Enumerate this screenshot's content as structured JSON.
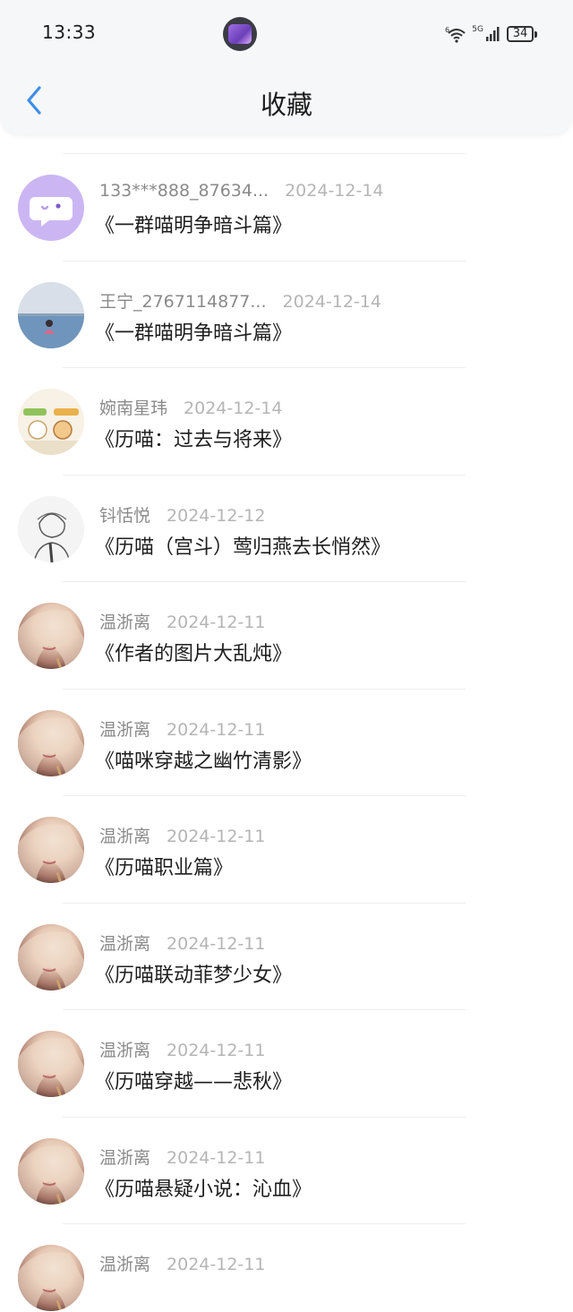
{
  "status_bar": {
    "time": "13:33",
    "network": "5G",
    "battery": "34"
  },
  "header": {
    "title": "收藏"
  },
  "items": [
    {
      "user": "133***888_87634...",
      "date": "2024-12-14",
      "title": "《一群喵明争暗斗篇》",
      "avatar": "chat-bubble-avatar"
    },
    {
      "user": "王宁_2767114877...",
      "date": "2024-12-14",
      "title": "《一群喵明争暗斗篇》",
      "avatar": "lake-photo-avatar"
    },
    {
      "user": "婉南星玮",
      "date": "2024-12-14",
      "title": "《历喵：过去与将来》",
      "avatar": "cartoon-cats-avatar"
    },
    {
      "user": "钭恬悦",
      "date": "2024-12-12",
      "title": "《历喵（宫斗）莺归燕去长悄然》",
      "avatar": "sketch-boy-avatar"
    },
    {
      "user": "温浙离",
      "date": "2024-12-11",
      "title": "《作者的图片大乱炖》",
      "avatar": "portrait-avatar"
    },
    {
      "user": "温浙离",
      "date": "2024-12-11",
      "title": "《喵咪穿越之幽竹清影》",
      "avatar": "portrait-avatar"
    },
    {
      "user": "温浙离",
      "date": "2024-12-11",
      "title": "《历喵职业篇》",
      "avatar": "portrait-avatar"
    },
    {
      "user": "温浙离",
      "date": "2024-12-11",
      "title": "《历喵联动菲梦少女》",
      "avatar": "portrait-avatar"
    },
    {
      "user": "温浙离",
      "date": "2024-12-11",
      "title": "《历喵穿越——悲秋》",
      "avatar": "portrait-avatar"
    },
    {
      "user": "温浙离",
      "date": "2024-12-11",
      "title": "《历喵悬疑小说：沁血》",
      "avatar": "portrait-avatar"
    },
    {
      "user": "温浙离",
      "date": "2024-12-11",
      "title": "",
      "avatar": "portrait-avatar"
    }
  ],
  "colors": {
    "accent": "#3d8ee8",
    "header_bg": "#f6f7f9"
  }
}
